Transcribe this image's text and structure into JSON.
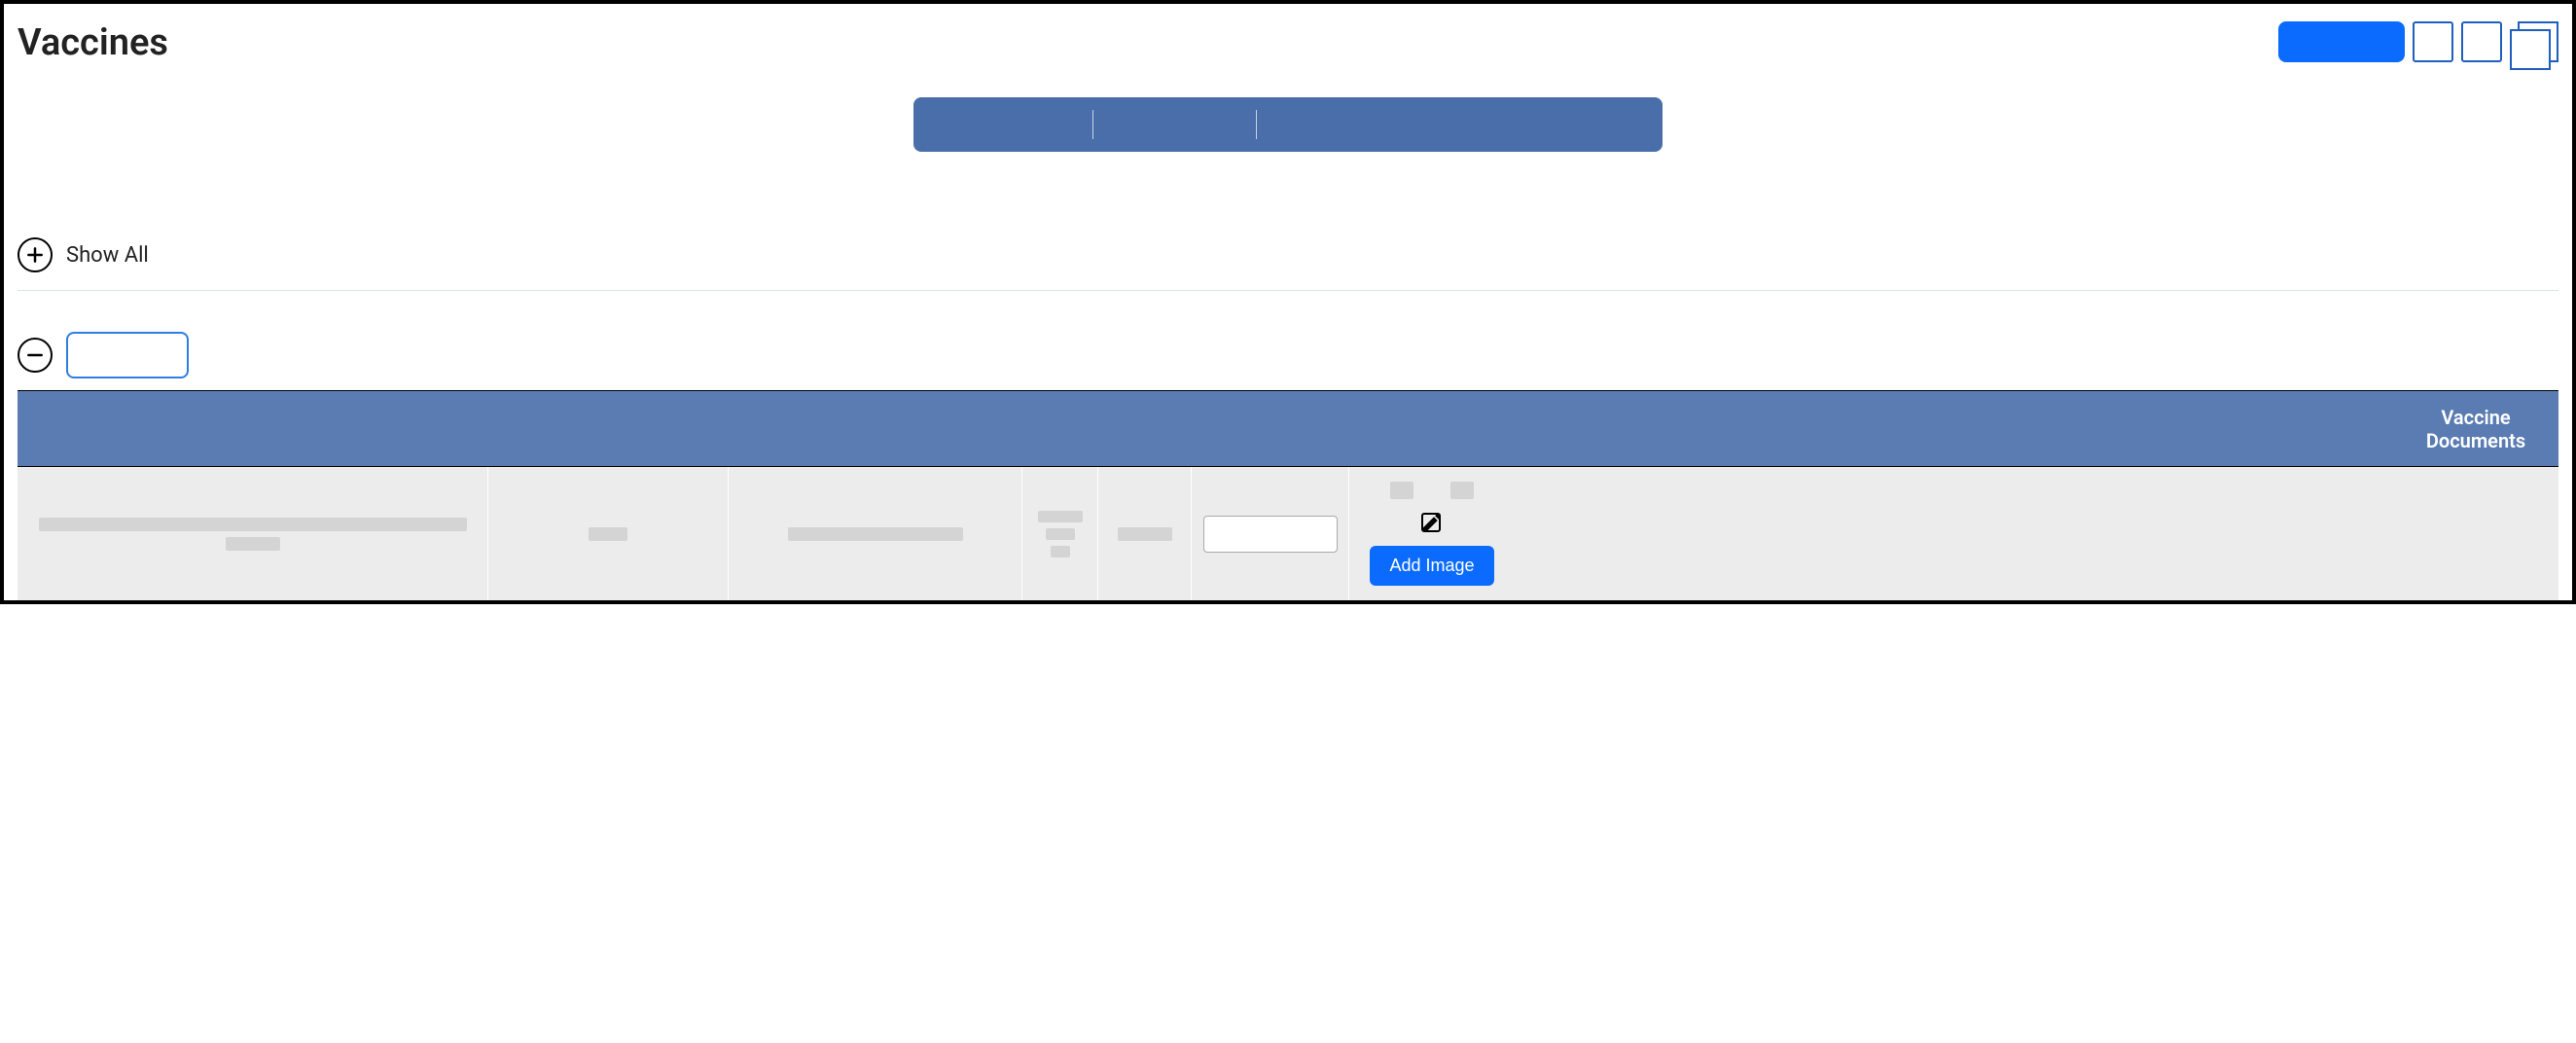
{
  "header": {
    "title": "Vaccines"
  },
  "controls": {
    "show_all_label": "Show All"
  },
  "table": {
    "headers": {
      "documents": "Vaccine Documents"
    },
    "actions": {
      "add_image_label": "Add Image"
    }
  }
}
